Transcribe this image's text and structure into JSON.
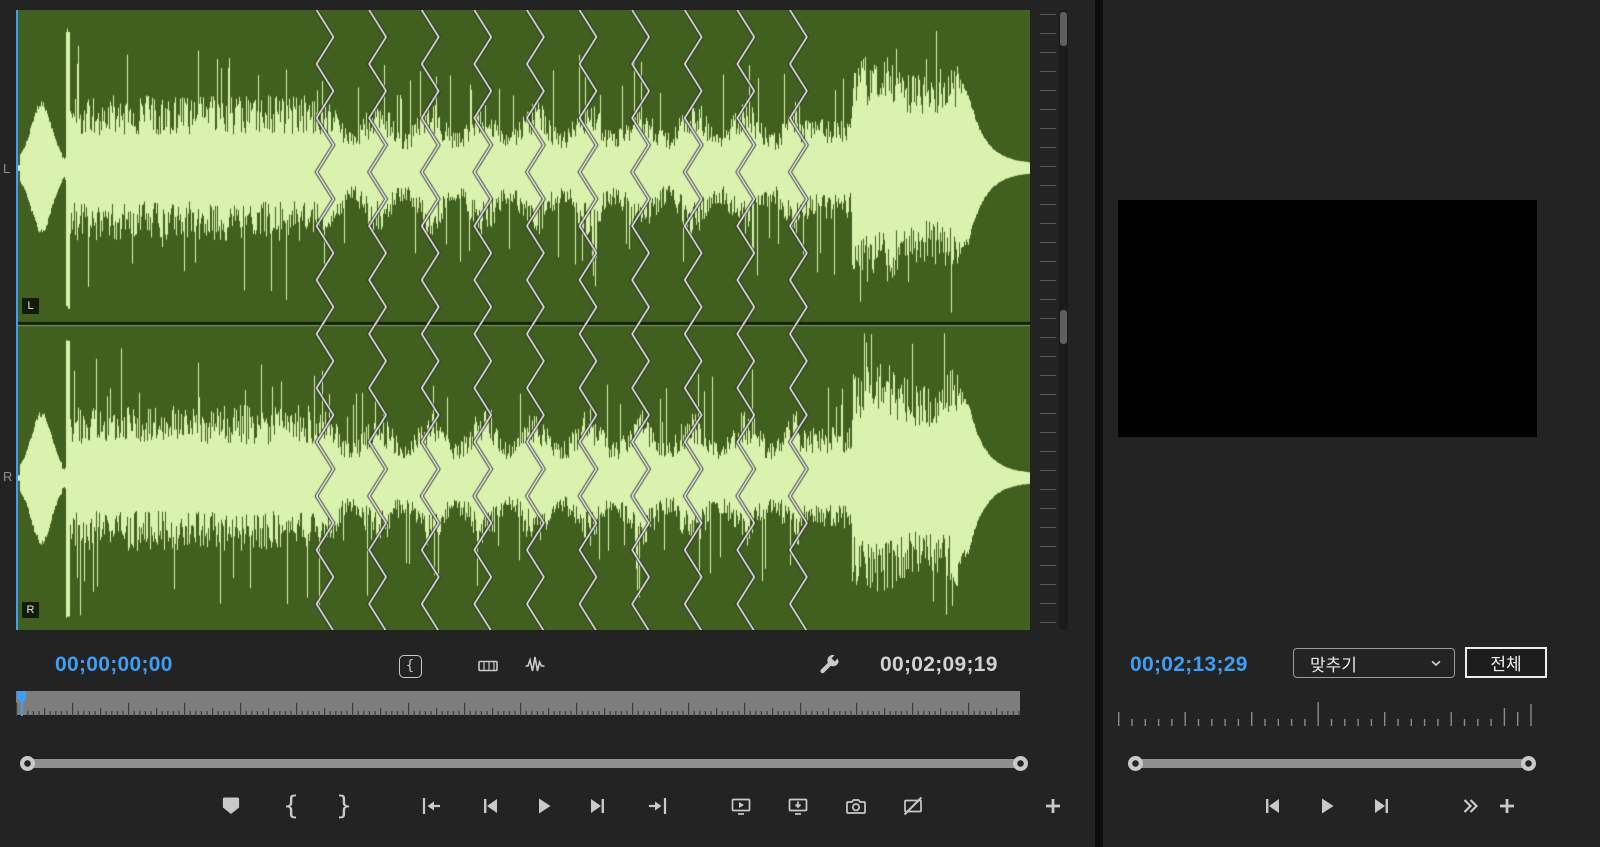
{
  "colors": {
    "bg": "#232323",
    "accent_blue": "#3f9ef4",
    "wave_bg": "#41601f",
    "wave_fg": "#d9f2ae",
    "icon_gray": "#c9c9c9"
  },
  "source_monitor": {
    "timecode_current": "00;00;00;00",
    "timecode_duration": "00;02;09;19",
    "channels": {
      "left_label": "L",
      "right_label": "R",
      "left_badge": "L",
      "right_badge": "R"
    },
    "toolbar": {
      "mark_in_glyph": "{",
      "mark_out_glyph": "}",
      "brace_button_glyph": "{"
    }
  },
  "program_monitor": {
    "timecode_current": "00;02;13;29",
    "fit_dropdown_value": "맞추기",
    "full_button_label": "전체"
  },
  "icons": {
    "add_marker": "bookmark-shape",
    "mark_in": "open-brace",
    "mark_out": "close-brace",
    "go_to_in": "bar-with-left-arrow",
    "step_back": "bar-with-left-triangle",
    "play": "right-triangle",
    "step_forward": "right-triangle-with-bar",
    "go_to_out": "right-arrow-with-bar",
    "insert": "monitor-with-play",
    "overwrite": "monitor-with-down-arrow",
    "export_frame": "camera",
    "fx_mute": "slashed-frame",
    "button_editor": "plus",
    "settings": "wrench",
    "drag_video": "filmstrip",
    "drag_audio": "waveform-zigzag",
    "fit_chevron": "chevron-down",
    "more_buttons": "double-chevron-right"
  }
}
